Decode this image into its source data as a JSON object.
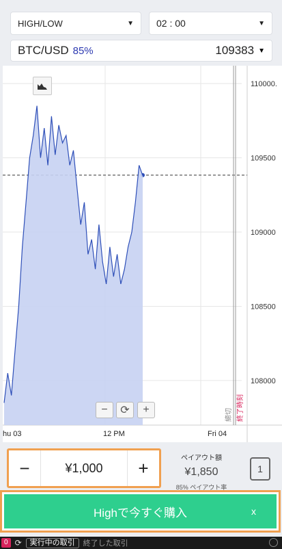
{
  "header": {
    "mode": {
      "label": "HIGH/LOW"
    },
    "duration": {
      "label": "02 : 00"
    }
  },
  "asset": {
    "name": "BTC/USD",
    "payout": "85%",
    "price": "109383"
  },
  "chart_data": {
    "type": "area",
    "ylim": [
      107700,
      110120
    ],
    "y_ticks": [
      110000,
      109500,
      109000,
      108500,
      108000
    ],
    "y_tick_labels": [
      "110000.",
      "109500",
      "109000",
      "108500",
      "108000"
    ],
    "x_tick_labels": [
      "hu 03",
      "12 PM",
      "Fri 04"
    ],
    "current_price": 109383,
    "deadline_label": "締切",
    "expiry_label": "終了時刻",
    "series": [
      {
        "values": [
          107850,
          108050,
          107900,
          108200,
          108500,
          108900,
          109200,
          109500,
          109650,
          109850,
          109500,
          109700,
          109450,
          109780,
          109520,
          109720,
          109600,
          109650,
          109450,
          109550,
          109300,
          109050,
          109200,
          108850,
          108950,
          108750,
          109050,
          108800,
          108650,
          108900,
          108700,
          108850,
          108650,
          108750,
          108900,
          109000,
          109200,
          109450,
          109380
        ]
      }
    ]
  },
  "chart_controls": {
    "zoom_out": "−",
    "reset": "⟳",
    "zoom_in": "+"
  },
  "trade": {
    "minus": "−",
    "amount": "¥1,000",
    "plus": "+",
    "payout_label": "ペイアウト額",
    "payout_amount": "¥1,850",
    "payout_rate": "85% ペイアウト率",
    "one_click": "1"
  },
  "buy": {
    "label": "Highで今すぐ購入",
    "close": "x"
  },
  "bottom": {
    "count": "0",
    "open_trades": "実行中の取引",
    "closed_trades": "終了した取引"
  },
  "colors": {
    "accent": "#2d3ab1",
    "buy": "#2ecf8e",
    "highlight": "#f0a050",
    "area": "#c7d2f2",
    "line": "#2e4fb8"
  },
  "icons": {
    "mode_caret": "caret-down-icon",
    "duration_caret": "caret-down-icon",
    "asset_caret": "caret-down-icon",
    "chart_type": "area-chart-icon",
    "reset": "refresh-icon"
  }
}
